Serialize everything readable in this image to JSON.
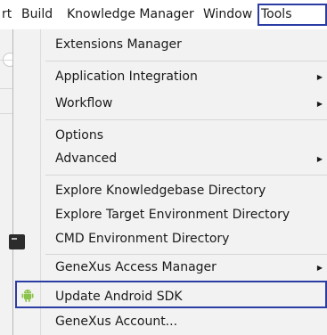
{
  "menubar": {
    "items": [
      {
        "label": "rt"
      },
      {
        "label": "Build"
      },
      {
        "label": "Knowledge Manager"
      },
      {
        "label": "Window"
      },
      {
        "label": "Tools"
      }
    ]
  },
  "tools_menu": {
    "items": [
      {
        "label": "Extensions Manager"
      },
      {
        "label": "Application Integration"
      },
      {
        "label": "Workflow"
      },
      {
        "label": "Options"
      },
      {
        "label": "Advanced"
      },
      {
        "label": "Explore Knowledgebase Directory"
      },
      {
        "label": "Explore Target Environment Directory"
      },
      {
        "label": "CMD Environment Directory"
      },
      {
        "label": "GeneXus Access Manager"
      },
      {
        "label": "Update Android SDK"
      },
      {
        "label": "GeneXus Account..."
      }
    ]
  },
  "colors": {
    "highlight_border": "#2b3ca5",
    "android_green": "#8bc34a"
  }
}
